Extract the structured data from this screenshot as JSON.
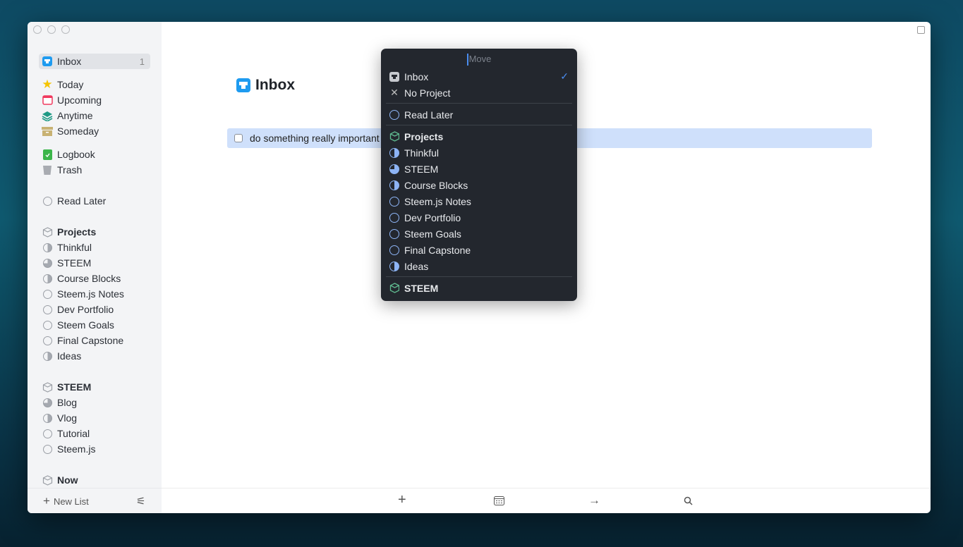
{
  "sidebar": {
    "inbox": {
      "label": "Inbox",
      "count": "1"
    },
    "items1": [
      "Today",
      "Upcoming",
      "Anytime",
      "Someday"
    ],
    "items2": [
      "Logbook",
      "Trash"
    ],
    "read_later": "Read Later",
    "projects": {
      "label": "Projects",
      "items": [
        "Thinkful",
        "STEEM",
        "Course Blocks",
        "Steem.js Notes",
        "Dev Portfolio",
        "Steem Goals",
        "Final Capstone",
        "Ideas"
      ]
    },
    "steem": {
      "label": "STEEM",
      "items": [
        "Blog",
        "Vlog",
        "Tutorial",
        "Steem.js"
      ]
    },
    "now": "Now",
    "new_list": "New List"
  },
  "main": {
    "title": "Inbox",
    "task": "do something really important"
  },
  "popup": {
    "label": "Move",
    "inbox": "Inbox",
    "no_project": "No Project",
    "read_later": "Read Later",
    "projects": "Projects",
    "items": [
      "Thinkful",
      "STEEM",
      "Course Blocks",
      "Steem.js Notes",
      "Dev Portfolio",
      "Steem Goals",
      "Final Capstone",
      "Ideas"
    ],
    "steem": "STEEM"
  },
  "colors": {
    "accent": "#4a8df0",
    "selection": "#cfe0fb"
  }
}
